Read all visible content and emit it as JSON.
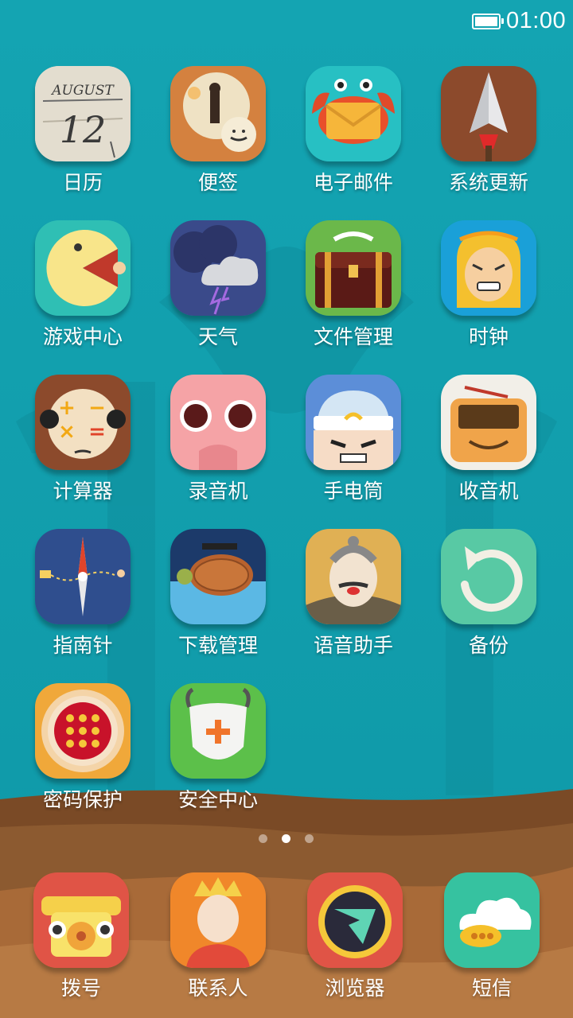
{
  "status_bar": {
    "time": "01:00",
    "battery_icon": "battery-full-icon"
  },
  "apps": [
    {
      "id": "calendar",
      "label": "日历",
      "icon": "calendar-icon",
      "icon_text": "AUGUST",
      "icon_day": "12"
    },
    {
      "id": "notes",
      "label": "便签",
      "icon": "notes-icon"
    },
    {
      "id": "email",
      "label": "电子邮件",
      "icon": "email-crab-icon"
    },
    {
      "id": "update",
      "label": "系统更新",
      "icon": "spear-update-icon"
    },
    {
      "id": "games",
      "label": "游戏中心",
      "icon": "pacman-game-icon"
    },
    {
      "id": "weather",
      "label": "天气",
      "icon": "storm-cloud-icon"
    },
    {
      "id": "files",
      "label": "文件管理",
      "icon": "treasure-chest-icon"
    },
    {
      "id": "clock",
      "label": "时钟",
      "icon": "monkey-king-clock-icon"
    },
    {
      "id": "calculator",
      "label": "计算器",
      "icon": "calculator-face-icon"
    },
    {
      "id": "recorder",
      "label": "录音机",
      "icon": "pig-recorder-icon"
    },
    {
      "id": "flashlight",
      "label": "手电筒",
      "icon": "flashlight-face-icon"
    },
    {
      "id": "radio",
      "label": "收音机",
      "icon": "radio-face-icon"
    },
    {
      "id": "compass",
      "label": "指南针",
      "icon": "compass-icon"
    },
    {
      "id": "downloads",
      "label": "下载管理",
      "icon": "turtle-download-icon"
    },
    {
      "id": "assistant",
      "label": "语音助手",
      "icon": "monk-assistant-icon"
    },
    {
      "id": "backup",
      "label": "备份",
      "icon": "backup-arrow-icon"
    },
    {
      "id": "password",
      "label": "密码保护",
      "icon": "flower-keypad-icon"
    },
    {
      "id": "security",
      "label": "安全中心",
      "icon": "shield-security-icon"
    }
  ],
  "page_indicator": {
    "count": 3,
    "active": 2
  },
  "dock": [
    {
      "id": "dialer",
      "label": "拨号",
      "icon": "telephone-icon"
    },
    {
      "id": "contacts",
      "label": "联系人",
      "icon": "contacts-person-icon"
    },
    {
      "id": "browser",
      "label": "浏览器",
      "icon": "fire-ring-browser-icon"
    },
    {
      "id": "messages",
      "label": "短信",
      "icon": "cloud-message-icon"
    }
  ]
}
